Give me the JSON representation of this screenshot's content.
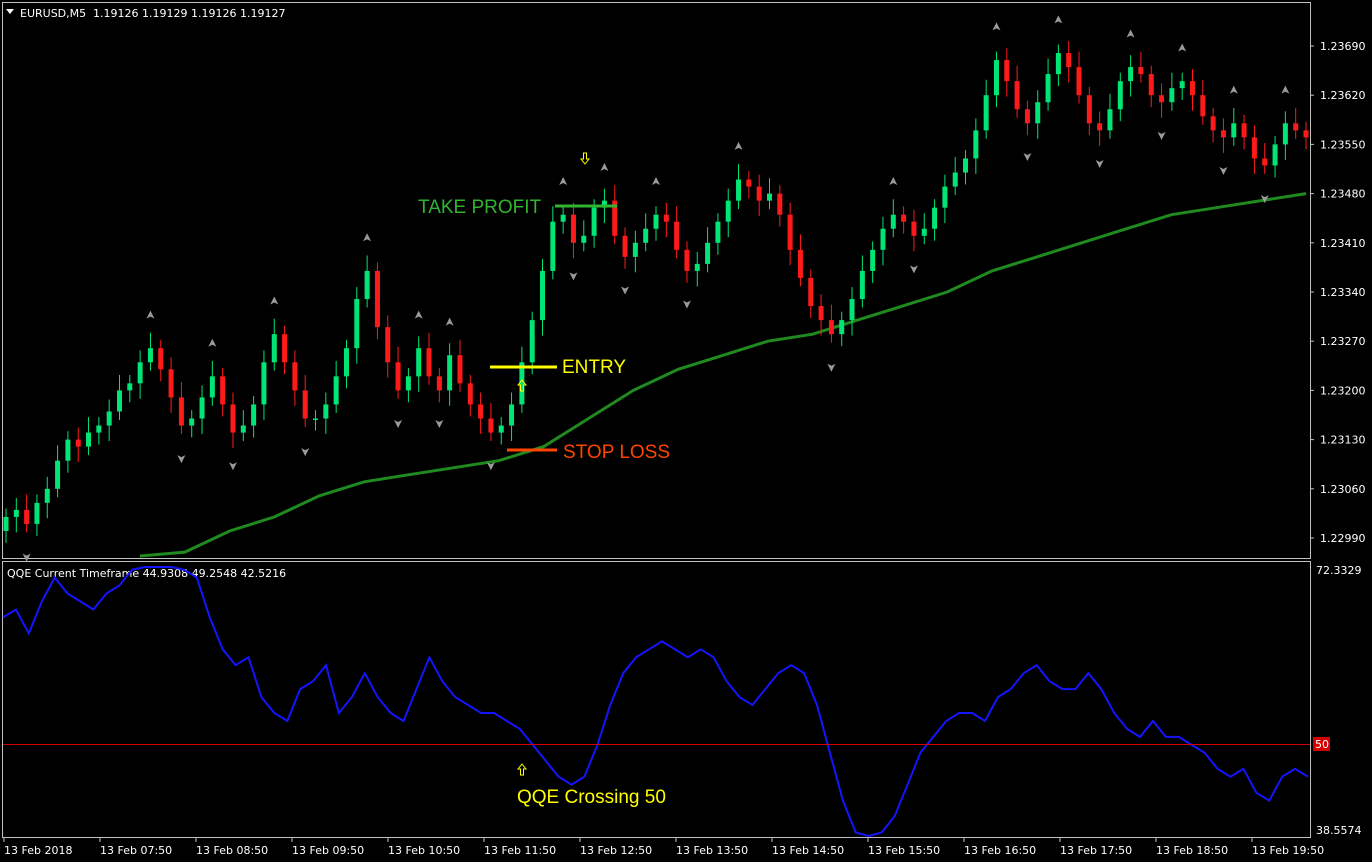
{
  "colors": {
    "background": "#000000",
    "frame": "#c0c0c0",
    "bull": "#00e676",
    "bear": "#ff1a1a",
    "ma": "#1f8a1f",
    "qqe": "#1414ff",
    "level50": "#d40000",
    "entry": "#ffff00",
    "stop": "#ff4500",
    "take_profit": "#31b531",
    "fractal": "#9a9a9a",
    "qqe_label": "#ffff00"
  },
  "header": {
    "symbol": "EURUSD,M5",
    "quote": "1.19126 1.19129 1.19126 1.19127"
  },
  "indicator": {
    "title": "QQE Current Timeframe 44.9308 49.2548 42.5216",
    "level_label": "50"
  },
  "annotations": {
    "take_profit": "TAKE PROFIT",
    "entry": "ENTRY",
    "stop_loss": "STOP LOSS",
    "qqe_cross": "QQE Crossing 50"
  },
  "chart_data": [
    {
      "type": "candlestick",
      "title": "EURUSD,M5",
      "y_ticks": [
        "1.23690",
        "1.23620",
        "1.23550",
        "1.23480",
        "1.23410",
        "1.23340",
        "1.23270",
        "1.23200",
        "1.23130",
        "1.23060",
        "1.22990"
      ],
      "ylim": [
        1.2295,
        1.2373
      ],
      "grid": false,
      "levels": {
        "take_profit": 1.2346,
        "entry": 1.2324,
        "stop_loss": 1.2312
      },
      "close_series": [
        1.2302,
        1.2303,
        1.2301,
        1.2304,
        1.2306,
        1.231,
        1.2313,
        1.2312,
        1.2314,
        1.2315,
        1.2317,
        1.232,
        1.2321,
        1.2324,
        1.2326,
        1.2323,
        1.2319,
        1.2315,
        1.2316,
        1.2319,
        1.2322,
        1.2318,
        1.2314,
        1.2315,
        1.2318,
        1.2324,
        1.2328,
        1.2324,
        1.232,
        1.2316,
        1.2316,
        1.2318,
        1.2322,
        1.2326,
        1.2333,
        1.2337,
        1.2329,
        1.2324,
        1.232,
        1.2322,
        1.2326,
        1.2322,
        1.232,
        1.2325,
        1.2321,
        1.2318,
        1.2316,
        1.2314,
        1.2315,
        1.2318,
        1.2324,
        1.233,
        1.2337,
        1.2344,
        1.2345,
        1.2341,
        1.2342,
        1.2346,
        1.2347,
        1.2342,
        1.2339,
        1.2341,
        1.2343,
        1.2345,
        1.2344,
        1.234,
        1.2337,
        1.2338,
        1.2341,
        1.2344,
        1.2347,
        1.235,
        1.2349,
        1.2347,
        1.2348,
        1.2345,
        1.234,
        1.2336,
        1.2332,
        1.233,
        1.2328,
        1.233,
        1.2333,
        1.2337,
        1.234,
        1.2343,
        1.2345,
        1.2344,
        1.2342,
        1.2343,
        1.2346,
        1.2349,
        1.2351,
        1.2353,
        1.2357,
        1.2362,
        1.2367,
        1.2364,
        1.236,
        1.2358,
        1.2361,
        1.2365,
        1.2368,
        1.2366,
        1.2362,
        1.2358,
        1.2357,
        1.236,
        1.2364,
        1.2366,
        1.2365,
        1.2362,
        1.2361,
        1.2363,
        1.2364,
        1.2362,
        1.2359,
        1.2357,
        1.2356,
        1.2358,
        1.2356,
        1.2353,
        1.2352,
        1.2355,
        1.2358,
        1.2357,
        1.2356
      ],
      "ma_series": [
        1.2294,
        1.2297,
        1.23,
        1.2302,
        1.2305,
        1.2307,
        1.2308,
        1.2309,
        1.231,
        1.2312,
        1.2316,
        1.232,
        1.2323,
        1.2325,
        1.2327,
        1.2328,
        1.233,
        1.2332,
        1.2334,
        1.2337,
        1.2339,
        1.2341,
        1.2343,
        1.2345,
        1.2346,
        1.2347,
        1.2348
      ],
      "x_ticks": [
        "13 Feb 2018",
        "13 Feb 07:50",
        "13 Feb 08:50",
        "13 Feb 09:50",
        "13 Feb 10:50",
        "13 Feb 11:50",
        "13 Feb 12:50",
        "13 Feb 13:50",
        "13 Feb 14:50",
        "13 Feb 15:50",
        "13 Feb 16:50",
        "13 Feb 17:50",
        "13 Feb 18:50",
        "13 Feb 19:50"
      ]
    },
    {
      "type": "line",
      "title": "QQE Current Timeframe",
      "y_max_label": "72.3329",
      "y_min_label": "38.5574",
      "ylim": [
        38.5574,
        72.3329
      ],
      "level": 50,
      "series": [
        66,
        67,
        64,
        68,
        71,
        69,
        68,
        67,
        69,
        70,
        72,
        73,
        74,
        73,
        72,
        71,
        66,
        62,
        60,
        61,
        56,
        54,
        53,
        57,
        58,
        60,
        54,
        56,
        59,
        56,
        54,
        53,
        57,
        61,
        58,
        56,
        55,
        54,
        54,
        53,
        52,
        50,
        48,
        46,
        45,
        46,
        50,
        55,
        59,
        61,
        62,
        63,
        62,
        61,
        62,
        61,
        58,
        56,
        55,
        57,
        59,
        60,
        59,
        55,
        49,
        43,
        39,
        38,
        39,
        41,
        45,
        49,
        51,
        53,
        54,
        54,
        53,
        56,
        57,
        59,
        60,
        58,
        57,
        57,
        59,
        57,
        54,
        52,
        51,
        53,
        51,
        51,
        50,
        49,
        47,
        46,
        47,
        44,
        43,
        46,
        47,
        46
      ]
    }
  ]
}
